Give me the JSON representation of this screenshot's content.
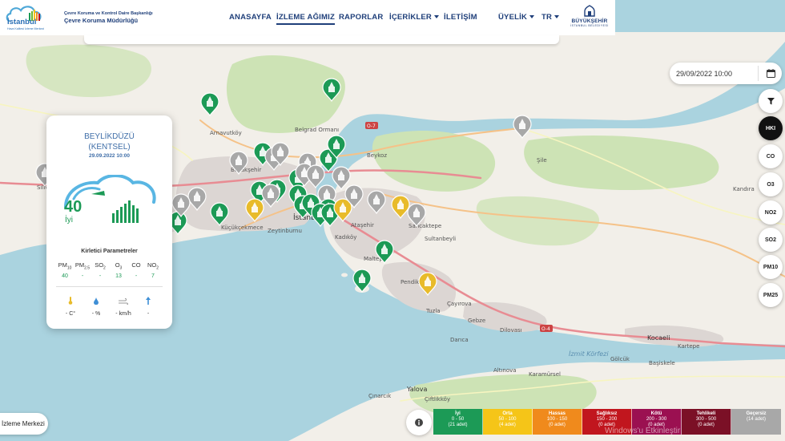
{
  "header": {
    "logo_text": "İstanbul",
    "logo_tagline": "Hava Kalitesi İzleme Merkezi",
    "department_line1": "Çevre Koruma ve Kontrol Daire Başkanlığı",
    "department_line2": "Çevre Koruma Müdürlüğü",
    "nav": [
      {
        "label": "ANASAYFA"
      },
      {
        "label": "İZLEME AĞIMIZ"
      },
      {
        "label": "RAPORLAR"
      },
      {
        "label": "İÇERİKLER"
      },
      {
        "label": "İLETİŞİM"
      },
      {
        "label": "ÜYELİK"
      },
      {
        "label": "TR"
      }
    ],
    "ibb_line1": "İSTANBUL",
    "ibb_line2": "BÜYÜKŞEHİR",
    "ibb_line3": "BELEDİYESİ"
  },
  "date_filter": {
    "value": "29/09/2022 10:00"
  },
  "right_buttons": [
    {
      "label": "HKI"
    },
    {
      "label": "CO"
    },
    {
      "label": "O3"
    },
    {
      "label": "NO2"
    },
    {
      "label": "SO2"
    },
    {
      "label": "PM10"
    },
    {
      "label": "PM25"
    }
  ],
  "station": {
    "name_line1": "BEYLİKDÜZÜ",
    "name_line2": "(KENTSEL)",
    "date": "29.09.2022 10:00",
    "aqi_value": "40",
    "aqi_label": "İyi",
    "params_title": "Kirletici Parametreler",
    "params": [
      {
        "name": "PM10",
        "base": "PM",
        "sub": "10",
        "value": "40"
      },
      {
        "name": "PM2.5",
        "base": "PM",
        "sub": "2.5",
        "value": "-"
      },
      {
        "name": "SO2",
        "base": "SO",
        "sub": "2",
        "value": "-"
      },
      {
        "name": "O3",
        "base": "O",
        "sub": "3",
        "value": "13"
      },
      {
        "name": "CO",
        "base": "CO",
        "sub": "",
        "value": "-"
      },
      {
        "name": "NO2",
        "base": "NO",
        "sub": "2",
        "value": "7"
      }
    ],
    "weather": [
      {
        "icon": "thermometer-icon",
        "value": "- C°"
      },
      {
        "icon": "humidity-drop-icon",
        "value": "- %"
      },
      {
        "icon": "wind-icon",
        "value": "- km/h"
      },
      {
        "icon": "wind-direction-arrow-icon",
        "value": "-"
      }
    ]
  },
  "center_button": {
    "label": "İzleme Merkezi"
  },
  "legend": [
    {
      "name": "İyi",
      "range": "0 - 50",
      "count": "(21 adet)",
      "color": "#1c9a56"
    },
    {
      "name": "Orta",
      "range": "50 - 100",
      "count": "(4 adet)",
      "color": "#f5c518"
    },
    {
      "name": "Hassas",
      "range": "100 - 150",
      "count": "(0 adet)",
      "color": "#f08a1c"
    },
    {
      "name": "Sağlıksız",
      "range": "150 - 200",
      "count": "(0 adet)",
      "color": "#c1161e"
    },
    {
      "name": "Kötü",
      "range": "200 - 300",
      "count": "(0 adet)",
      "color": "#9b1051"
    },
    {
      "name": "Tehlikeli",
      "range": "300 - 500",
      "count": "(0 adet)",
      "color": "#7b1026"
    },
    {
      "name": "Geçersiz",
      "range": "",
      "count": "(14 adet)",
      "color": "#a8a8a8"
    }
  ],
  "watermark": "Windows'u Etkinleştir",
  "map": {
    "places": [
      "İstanbul",
      "Arnavutköy",
      "Başakşehir",
      "Belgrad Ormanı",
      "Beykoz",
      "Şile",
      "Kandıra",
      "Zeytinburnu",
      "Küçükçekmece",
      "Kadıköy",
      "Ataşehir",
      "Sancaktepe",
      "Sultanbeyli",
      "Maltepe",
      "Pendik",
      "Tuzla",
      "Gebze",
      "Dilovası",
      "Darıca",
      "Çayırova",
      "Kocaeli",
      "Kartepe",
      "İzmit Körfezi",
      "Başiskele",
      "Gölcük",
      "Altınova",
      "Karamürsel",
      "Yalova",
      "Çiftlikköy",
      "Çınarcık",
      "Silivri"
    ],
    "road_shields": [
      "O-7",
      "O-4"
    ],
    "colors": {
      "good": "#1c9a56",
      "moderate": "#e8bb2a",
      "invalid": "#a8a8a8"
    }
  }
}
